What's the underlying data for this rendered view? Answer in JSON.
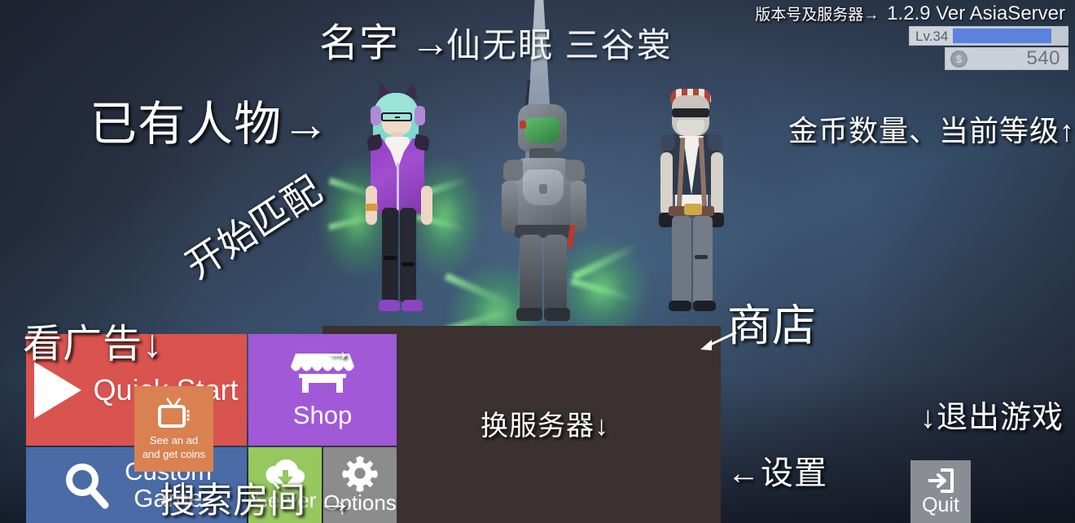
{
  "hud": {
    "version_annotation": "版本号及服务器→",
    "version_value": "1.2.9 Ver AsiaServer",
    "level_label": "Lv.34",
    "level_fill_percent": 86,
    "coin_value": "540",
    "coin_icon": "coin-dollar-icon"
  },
  "characters": {
    "name_annotation": "名字 →",
    "names": "仙无眠 三谷裳",
    "left_name": "仙无眠",
    "right_name": "三谷裳"
  },
  "buttons": {
    "quick_start": "Quick Start",
    "shop": "Shop",
    "custom_game_line1": "Custom",
    "custom_game_line2": "Game",
    "server": "Server",
    "options": "Options",
    "quit": "Quit",
    "ad_line1": "See an ad",
    "ad_line2": "and get coins"
  },
  "annotations": {
    "existing_characters": "已有人物→",
    "coins_and_level": "金币数量、当前等级↑",
    "start_matching": "开始匹配",
    "start_matching_arrow": "→",
    "watch_ad": "看广告↓",
    "shop": "商店",
    "change_server": "换服务器↓",
    "settings": "←设置",
    "search_room": "搜索房间 →",
    "quit_game": "↓退出游戏"
  },
  "colors": {
    "quick_start_bg": "#d9534f",
    "shop_bg": "#a159d8",
    "custom_game_bg": "#4a6ba5",
    "server_bg": "#97c75f",
    "options_bg": "#8c8c8c",
    "quit_bg": "#8a8d93",
    "ad_bg": "#d98151",
    "panel_bg": "#3a3130",
    "level_fill": "#5b82de",
    "background_top": "#2a3142"
  }
}
